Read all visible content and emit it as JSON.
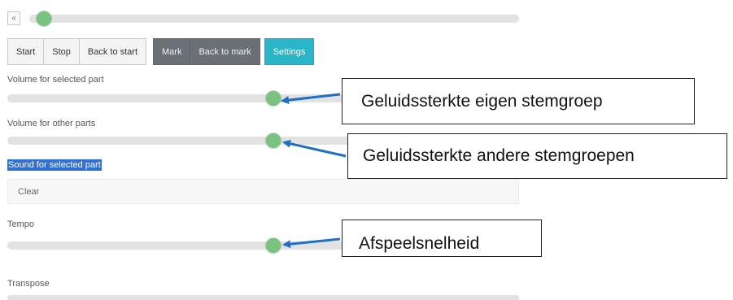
{
  "progress": {
    "button_glyph": "«",
    "position": 0.0
  },
  "toolbar": {
    "start_label": "Start",
    "stop_label": "Stop",
    "back_to_start_label": "Back to start",
    "mark_label": "Mark",
    "back_to_mark_label": "Back to mark",
    "settings_label": "Settings"
  },
  "settings": {
    "volume_selected_label": "Volume for selected part",
    "volume_selected_value": 0.53,
    "volume_other_label": "Volume for other parts",
    "volume_other_value": 0.53,
    "sound_selected_label": "Sound for selected part",
    "sound_selected_value": "Clear",
    "tempo_label": "Tempo",
    "tempo_value": 0.53,
    "transpose_label": "Transpose"
  },
  "callouts": {
    "own_voice_volume": "Geluidssterkte eigen stemgroep",
    "other_voices_volume": "Geluidssterkte andere stemgroepen",
    "playback_speed": "Afspeelsnelheid"
  },
  "colors": {
    "slider_knob": "#79c27f",
    "settings_button": "#2ab5c8",
    "dark_button": "#6b7077",
    "arrow": "#1f6fc2",
    "highlight": "#2f6fd6"
  }
}
